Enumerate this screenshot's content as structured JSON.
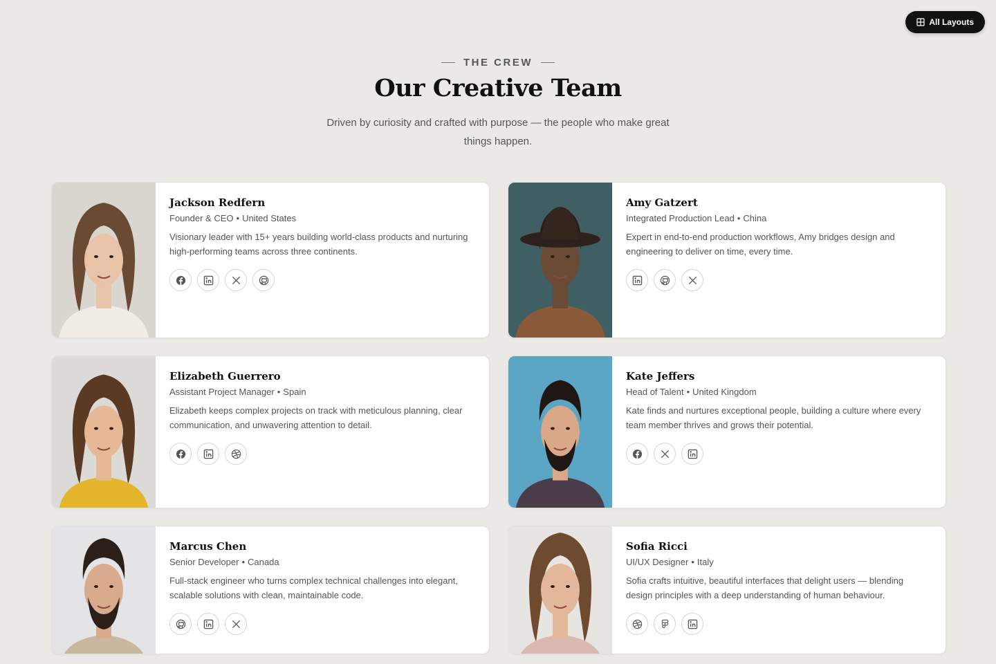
{
  "top_button": {
    "label": "All Layouts",
    "icon": "grid-icon"
  },
  "header": {
    "eyebrow": "THE CREW",
    "title": "Our Creative Team",
    "subtitle": "Driven by curiosity and crafted with purpose — the people who make great things happen."
  },
  "members": [
    {
      "name": "Jackson Redfern",
      "role": "Founder & CEO",
      "country": "United States",
      "bio": "Visionary leader with 15+ years building world-class products and nurturing high-performing teams across three continents.",
      "socials": [
        "facebook",
        "linkedin",
        "x",
        "github"
      ],
      "photo_bg": "#d9d6d0"
    },
    {
      "name": "Amy Gatzert",
      "role": "Integrated Production Lead",
      "country": "China",
      "bio": "Expert in end-to-end production workflows, Amy bridges design and engineering to deliver on time, every time.",
      "socials": [
        "linkedin",
        "github",
        "x"
      ],
      "photo_bg": "#3f5f62"
    },
    {
      "name": "Elizabeth Guerrero",
      "role": "Assistant Project Manager",
      "country": "Spain",
      "bio": "Elizabeth keeps complex projects on track with meticulous planning, clear communication, and unwavering attention to detail.",
      "socials": [
        "facebook",
        "linkedin",
        "dribbble"
      ],
      "photo_bg": "#dcdad6"
    },
    {
      "name": "Kate Jeffers",
      "role": "Head of Talent",
      "country": "United Kingdom",
      "bio": "Kate finds and nurtures exceptional people, building a culture where every team member thrives and grows their potential.",
      "socials": [
        "facebook",
        "x",
        "linkedin"
      ],
      "photo_bg": "#5aa6c4"
    },
    {
      "name": "Marcus Chen",
      "role": "Senior Developer",
      "country": "Canada",
      "bio": "Full-stack engineer who turns complex technical challenges into elegant, scalable solutions with clean, maintainable code.",
      "socials": [
        "github",
        "linkedin",
        "x"
      ],
      "photo_bg": "#e4e4e6"
    },
    {
      "name": "Sofia Ricci",
      "role": "UI/UX Designer",
      "country": "Italy",
      "bio": "Sofia crafts intuitive, beautiful interfaces that delight users — blending design principles with a deep understanding of human behaviour.",
      "socials": [
        "dribbble",
        "figma",
        "linkedin"
      ],
      "photo_bg": "#e7e5e2"
    }
  ]
}
